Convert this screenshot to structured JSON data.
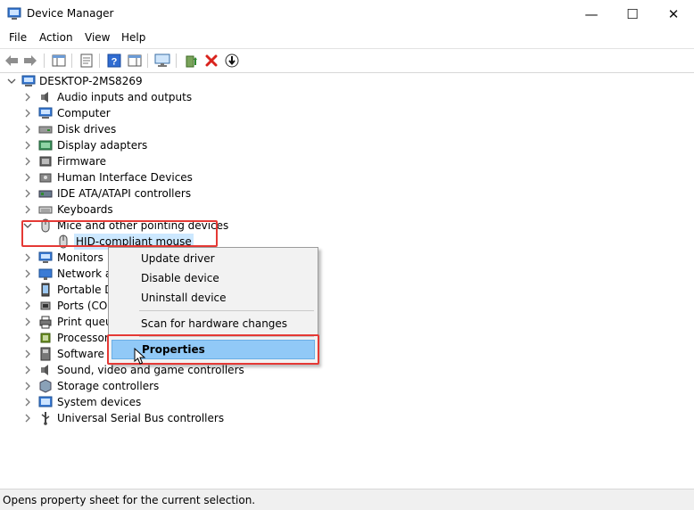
{
  "window": {
    "title": "Device Manager",
    "controls": {
      "minimize": "—",
      "maximize": "☐",
      "close": "✕"
    }
  },
  "menu": [
    "File",
    "Action",
    "View",
    "Help"
  ],
  "toolbar": {
    "buttons": [
      "back-icon",
      "forward-icon",
      "show-hide-console-tree-icon",
      "properties-icon",
      "help-icon",
      "action-pane-icon",
      "monitor-scan-icon",
      "update-driver-icon",
      "uninstall-icon",
      "download-icon"
    ]
  },
  "tree": {
    "root": "DESKTOP-2MS8269",
    "categories": [
      {
        "label": "Audio inputs and outputs",
        "icon": "speaker-icon"
      },
      {
        "label": "Computer",
        "icon": "computer-icon"
      },
      {
        "label": "Disk drives",
        "icon": "disk-drive-icon"
      },
      {
        "label": "Display adapters",
        "icon": "display-adapter-icon"
      },
      {
        "label": "Firmware",
        "icon": "firmware-icon"
      },
      {
        "label": "Human Interface Devices",
        "icon": "hid-icon"
      },
      {
        "label": "IDE ATA/ATAPI controllers",
        "icon": "ide-controller-icon"
      },
      {
        "label": "Keyboards",
        "icon": "keyboard-icon"
      },
      {
        "label": "Mice and other pointing devices",
        "icon": "mouse-icon",
        "expanded": true
      },
      {
        "label": "HID-compliant mouse",
        "icon": "mouse-icon",
        "child": true,
        "selected": true
      },
      {
        "label": "Monitors",
        "icon": "monitor-icon"
      },
      {
        "label": "Network ac",
        "icon": "network-adapter-icon"
      },
      {
        "label": "Portable De",
        "icon": "portable-device-icon"
      },
      {
        "label": "Ports (COM",
        "icon": "port-icon"
      },
      {
        "label": "Print queue",
        "icon": "printer-icon"
      },
      {
        "label": "Processors",
        "icon": "processor-icon"
      },
      {
        "label": "Software d",
        "icon": "software-device-icon"
      },
      {
        "label": "Sound, video and game controllers",
        "icon": "sound-icon"
      },
      {
        "label": "Storage controllers",
        "icon": "storage-controller-icon"
      },
      {
        "label": "System devices",
        "icon": "system-device-icon"
      },
      {
        "label": "Universal Serial Bus controllers",
        "icon": "usb-icon"
      }
    ]
  },
  "context_menu": {
    "items": [
      "Update driver",
      "Disable device",
      "Uninstall device",
      "Scan for hardware changes",
      "Properties"
    ],
    "highlighted": "Properties"
  },
  "status": "Opens property sheet for the current selection.",
  "colors": {
    "highlight_border": "#e53935",
    "selection": "#cce8ff",
    "menu_hover": "#91c9f7"
  }
}
